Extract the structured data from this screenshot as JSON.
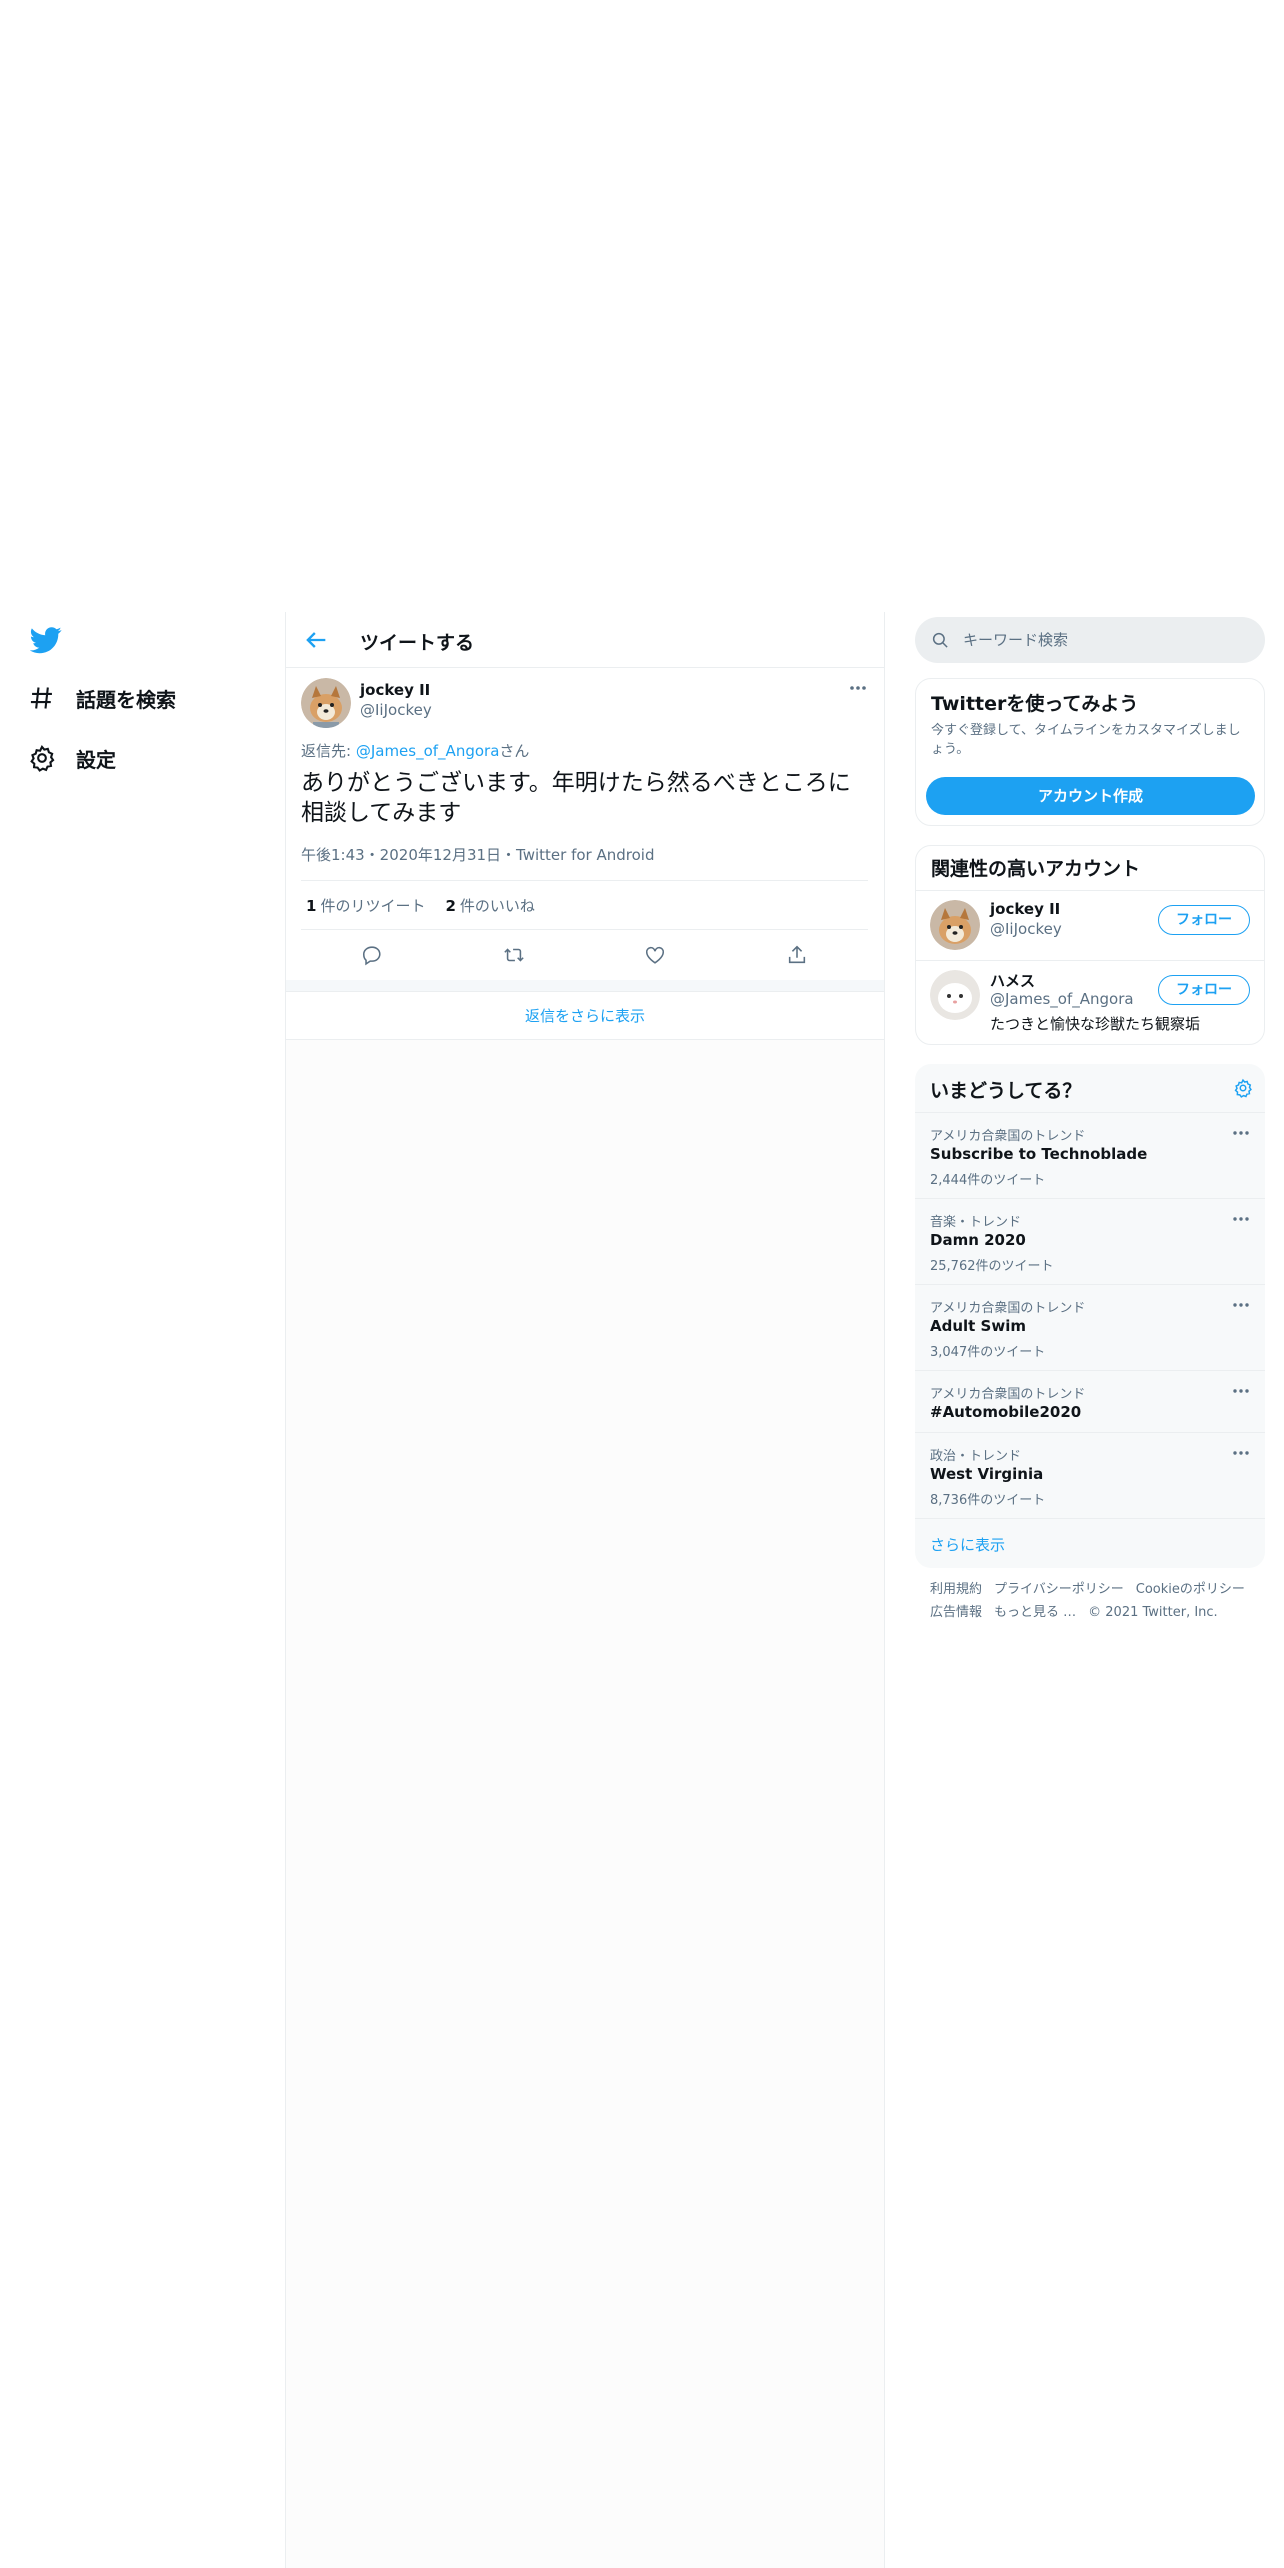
{
  "nav": {
    "items": [
      {
        "label": "話題を検索",
        "icon": "hashtag-icon"
      },
      {
        "label": "設定",
        "icon": "gear-icon"
      }
    ]
  },
  "header": {
    "title": "ツイートする"
  },
  "tweet": {
    "author_name": "jockey II",
    "author_handle": "@IiJockey",
    "reply_prefix": "返信先: ",
    "reply_handle": "@James_of_Angora",
    "reply_suffix": "さん",
    "text": "ありがとうございます。年明けたら然るべきところに相談してみます",
    "meta": "午後1:43・2020年12月31日・Twitter for Android",
    "retweet_count": "1",
    "retweet_label": "件のリツイート",
    "like_count": "2",
    "like_label": "件のいいね"
  },
  "show_more_replies": "返信をさらに表示",
  "search": {
    "placeholder": "キーワード検索"
  },
  "signup": {
    "title": "Twitterを使ってみよう",
    "description": "今すぐ登録して、タイムラインをカスタマイズしましょう。",
    "button": "アカウント作成"
  },
  "related": {
    "title": "関連性の高いアカウント",
    "follow_label": "フォロー",
    "accounts": [
      {
        "name": "jockey II",
        "handle": "@IiJockey",
        "bio": ""
      },
      {
        "name": "ハメス",
        "handle": "@James_of_Angora",
        "bio": "たつきと愉快な珍獣たち観察垢"
      }
    ]
  },
  "trends": {
    "title": "いまどうしてる？",
    "items": [
      {
        "context": "アメリカ合衆国のトレンド",
        "title": "Subscribe to Technoblade",
        "count": "2,444件のツイート"
      },
      {
        "context": "音楽・トレンド",
        "title": "Damn 2020",
        "count": "25,762件のツイート"
      },
      {
        "context": "アメリカ合衆国のトレンド",
        "title": "Adult Swim",
        "count": "3,047件のツイート"
      },
      {
        "context": "アメリカ合衆国のトレンド",
        "title": "#Automobile2020",
        "count": ""
      },
      {
        "context": "政治・トレンド",
        "title": "West Virginia",
        "count": "8,736件のツイート"
      }
    ],
    "show_more": "さらに表示"
  },
  "footer": {
    "links": [
      "利用規約",
      "プライバシーポリシー",
      "Cookieのポリシー",
      "広告情報",
      "もっと見る …"
    ],
    "copyright": "© 2021 Twitter, Inc."
  },
  "colors": {
    "accent": "#1da1f2",
    "text": "#0f1419",
    "secondary": "#5b7083",
    "border": "#ebeef0"
  }
}
